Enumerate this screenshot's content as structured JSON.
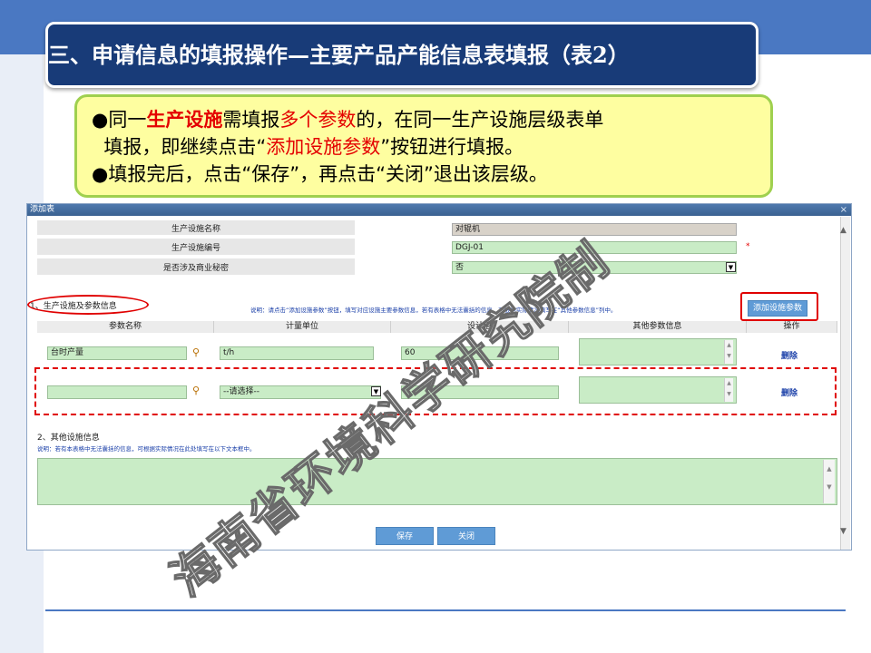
{
  "slide": {
    "title": "三、申请信息的填报操作—主要产品产能信息表填报（表2）",
    "notes": {
      "l1_a": "●同一",
      "l1_b": "生产设施",
      "l1_c": "需填报",
      "l1_d": "多个参数",
      "l1_e": "的，在同一生产设施层级表单",
      "l2_a": "  填报，即继续点击“",
      "l2_b": "添加设施参数",
      "l2_c": "”按钮进行填报。",
      "l3": "●填报完后，点击“保存”，再点击“关闭”退出该层级。"
    },
    "watermark": "海南省环境科学研究院制"
  },
  "dialog": {
    "title": "添加表",
    "close": "×",
    "facility": {
      "name_label": "生产设施名称",
      "name_value": "对辊机",
      "code_label": "生产设施编号",
      "code_value": "DGJ-01",
      "required_mark": "*",
      "secret_label": "是否涉及商业秘密",
      "secret_value": "否"
    },
    "section1": {
      "title": "1、生产设施及参数信息",
      "note": "说明：请点击“添加设施参数”按钮，填写对应设施主要参数信息，若有表格中无法囊括的信息，可根据实际情况填写在“其他参数信息”列中。",
      "add_button": "添加设施参数",
      "headers": [
        "参数名称",
        "计量单位",
        "设计值",
        "其他参数信息",
        "操作"
      ],
      "rows": [
        {
          "name": "台时产量",
          "unit": "t/h",
          "design": "60",
          "other": "",
          "action": "删除"
        },
        {
          "name": "",
          "unit": "--请选择--",
          "design": "",
          "other": "",
          "action": "删除"
        }
      ]
    },
    "section2": {
      "title": "2、其他设施信息",
      "note": "说明：若有本表格中无法囊括的信息，可根据实际情况在此处填写在以下文本框中。"
    },
    "buttons": {
      "save": "保存",
      "close": "关闭"
    }
  },
  "colors": {
    "accent": "#4a78c2",
    "title_bg": "#183b78",
    "note_bg": "#fefea0",
    "highlight": "#e40000",
    "field_green": "#c9ecc6"
  }
}
